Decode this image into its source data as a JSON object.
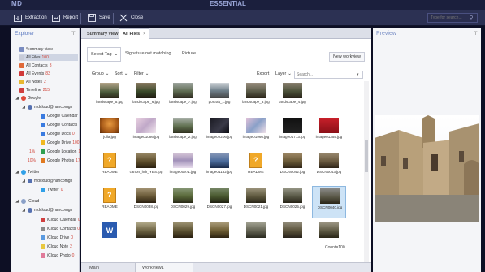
{
  "app": {
    "logo_text": "MD",
    "doc_title": "ESSENTIAL"
  },
  "toolbar": {
    "extraction_label": "Extraction",
    "report_label": "Report",
    "save_label": "Save",
    "close_label": "Close",
    "search_placeholder": "Type for search..."
  },
  "explorer": {
    "title": "Explorer",
    "items": [
      {
        "label": "Summary view",
        "count": ""
      },
      {
        "label": "All Files",
        "count": "100"
      },
      {
        "label": "All Contacts",
        "count": "3"
      },
      {
        "label": "All Events",
        "count": "83"
      },
      {
        "label": "All Notes",
        "count": "2"
      },
      {
        "label": "Timeline",
        "count": "215"
      },
      {
        "label": "Google",
        "count": ""
      },
      {
        "label": "mdcloud@hancomgn",
        "count": ""
      },
      {
        "label": "Google Calendar",
        "count": ""
      },
      {
        "label": "Google Contacts",
        "count": ""
      },
      {
        "label": "Google Docs",
        "count": "0"
      },
      {
        "label": "Google Drive",
        "count": "100"
      },
      {
        "label": "Google Location",
        "count": "1"
      },
      {
        "label": "Google Photos",
        "count": "17"
      },
      {
        "label": "Twitter",
        "count": ""
      },
      {
        "label": "mdcloud@hancomgn",
        "count": ""
      },
      {
        "label": "Twitter",
        "count": "0"
      },
      {
        "label": "iCloud",
        "count": ""
      },
      {
        "label": "mdcloud@hancomgn",
        "count": ""
      },
      {
        "label": "iCloud Calendar",
        "count": "0"
      },
      {
        "label": "iCloud Contacts",
        "count": "0"
      },
      {
        "label": "iCloud Drive",
        "count": "0"
      },
      {
        "label": "iCloud Note",
        "count": "2"
      },
      {
        "label": "iCloud Photo",
        "count": "0"
      }
    ],
    "side_percents": [
      "1%",
      "10%"
    ]
  },
  "center": {
    "tabs": [
      {
        "label": "Summary view"
      },
      {
        "label": "All Files"
      }
    ],
    "select_tag": "Select Tag",
    "signature": "Signature not matching",
    "picture": "Picture",
    "new_workview": "New workview",
    "group": "Group",
    "sort": "Sort",
    "filter": "Filter",
    "export": "Export",
    "layer": "Layer",
    "search_placeholder": "Search...",
    "files": [
      "landscape_5.jpg",
      "landscape_6.jpg",
      "landscape_7.jpg",
      "portrait_1.jpg",
      "landscape_3.jpg",
      "landscape_4.jpg",
      "jolla.jpg",
      "image01086.jpg",
      "landscape_2.jpg",
      "image02206.jpg",
      "image01966.jpg",
      "image01713.jpg",
      "image01355.jpg",
      "README",
      "canon_hdr_YES.jpg",
      "image00971.jpg",
      "image01132.jpg",
      "README",
      "DSCN0042.jpg",
      "DSCN0043.jpg",
      "README",
      "DSCN0038.jpg",
      "DSCN0029.jpg",
      "DSCN0027.jpg",
      "DSCN0021.jpg",
      "DSCN0025.jpg",
      "DSCN0040.jpg",
      "",
      "",
      "",
      "",
      "",
      "",
      ""
    ],
    "count_label": "Count=100",
    "bottom_tabs": [
      "Main",
      "Workview1"
    ]
  },
  "preview": {
    "title": "Preview"
  }
}
